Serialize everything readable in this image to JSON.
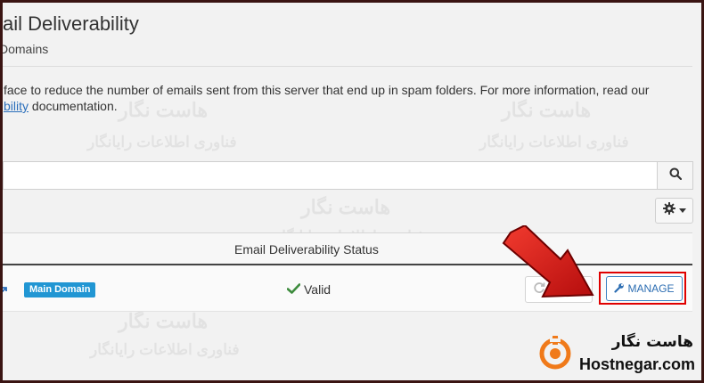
{
  "header": {
    "title": "ail Deliverability",
    "subtitle": "Domains"
  },
  "description": {
    "line1": "face to reduce the number of emails sent from this server that end up in spam folders. For more information, read our",
    "link_text": "bility",
    "line2_rest": " documentation."
  },
  "search": {
    "value": "",
    "button_icon": "search-icon"
  },
  "settings": {
    "button_icon": "gear-icon"
  },
  "table": {
    "status_header": "Email Deliverability Status",
    "rows": [
      {
        "badge": "Main Domain",
        "status": "Valid",
        "manage_label": "MANAGE"
      }
    ]
  },
  "watermark": {
    "fa_name": "هاست نگار",
    "fa_tagline": "فناوری اطلاعات رایانگار",
    "brand": "Hostnegar.com"
  },
  "colors": {
    "badge": "#2196d3",
    "link": "#2a6ebb",
    "valid_check": "#3c8b3c",
    "highlight": "#e00000",
    "arrow": "#d81515",
    "logo": "#f07a1a"
  }
}
